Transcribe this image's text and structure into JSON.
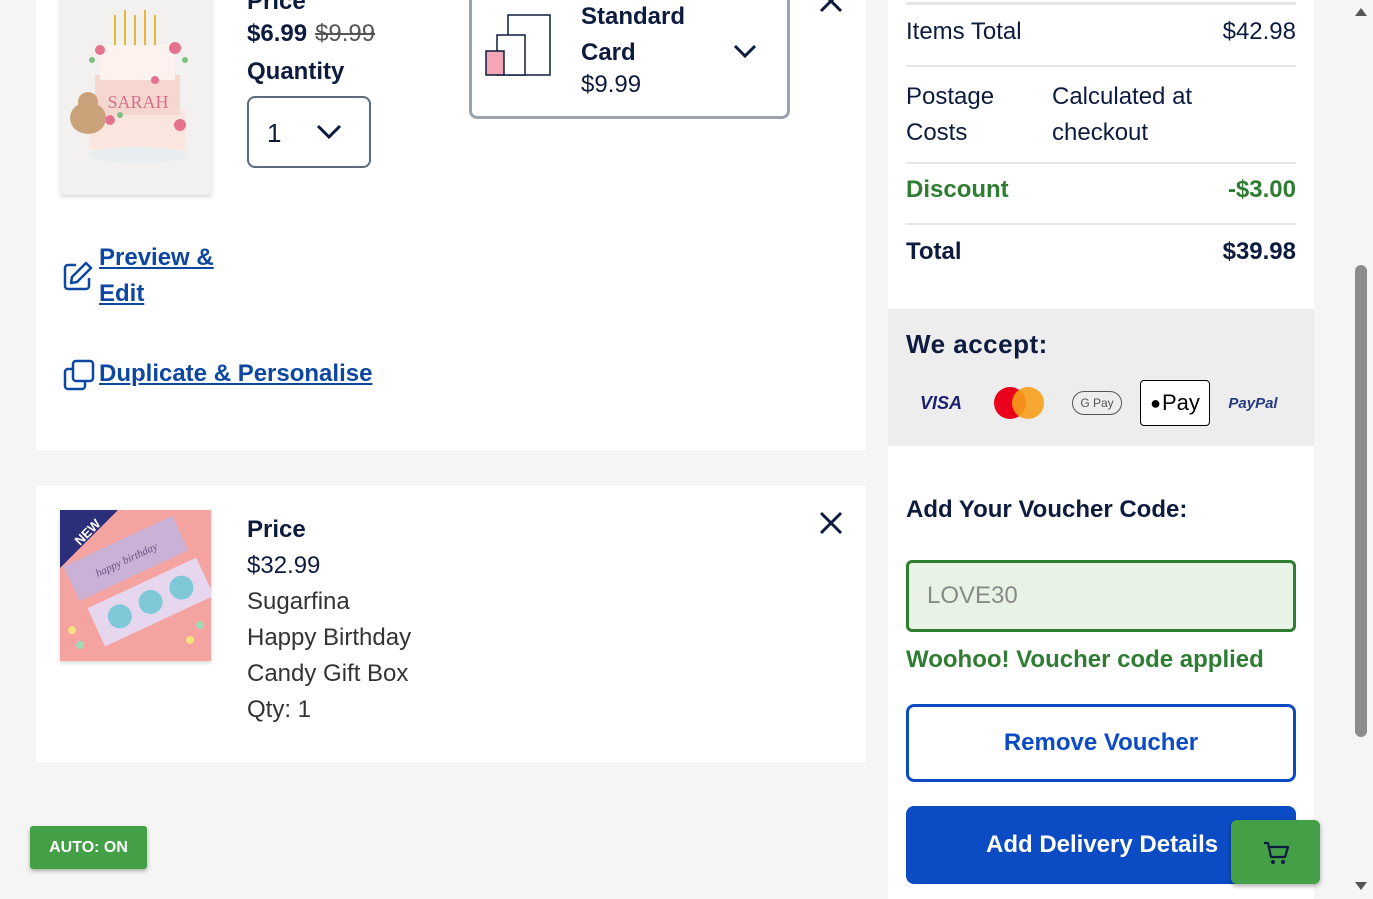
{
  "item1": {
    "price_label": "Price",
    "price_now": "$6.99",
    "price_was": "$9.99",
    "quantity_label": "Quantity",
    "quantity_value": "1",
    "size_line1": "Standard",
    "size_line2": "Card",
    "size_price": "$9.99",
    "preview_line1": "Preview &",
    "preview_line2": "Edit",
    "duplicate": "Duplicate & Personalise",
    "card_name": "SARAH"
  },
  "item2": {
    "badge": "NEW",
    "price_label": "Price",
    "price": "$32.99",
    "name_line1": "Sugarfina",
    "name_line2": "Happy Birthday",
    "name_line3": "Candy Gift Box",
    "qty": "Qty: 1",
    "box_text": "happy birthday"
  },
  "summary": {
    "items_total_label": "Items Total",
    "items_total": "$42.98",
    "postage_label_1": "Postage",
    "postage_label_2": "Costs",
    "postage_value_1": "Calculated at",
    "postage_value_2": "checkout",
    "discount_label": "Discount",
    "discount": "-$3.00",
    "total_label": "Total",
    "total": "$39.98",
    "accept_title": "We accept:",
    "payments": {
      "visa": "VISA",
      "gpay": "G Pay",
      "applepay": "Pay",
      "paypal": "PayPal"
    },
    "voucher_title": "Add Your Voucher Code:",
    "voucher_value": "LOVE30",
    "voucher_success": "Woohoo! Voucher code applied",
    "remove_voucher": "Remove Voucher",
    "add_delivery": "Add Delivery Details"
  },
  "auto_label": "AUTO: ON",
  "colors": {
    "navy": "#0d1b3e",
    "link_blue": "#0d47a1",
    "primary": "#0b4bc4",
    "green": "#2e7d32",
    "auto_green": "#43a047"
  },
  "icons": [
    "chevron-down-icon",
    "close-icon",
    "edit-icon",
    "duplicate-icon",
    "cart-icon"
  ]
}
